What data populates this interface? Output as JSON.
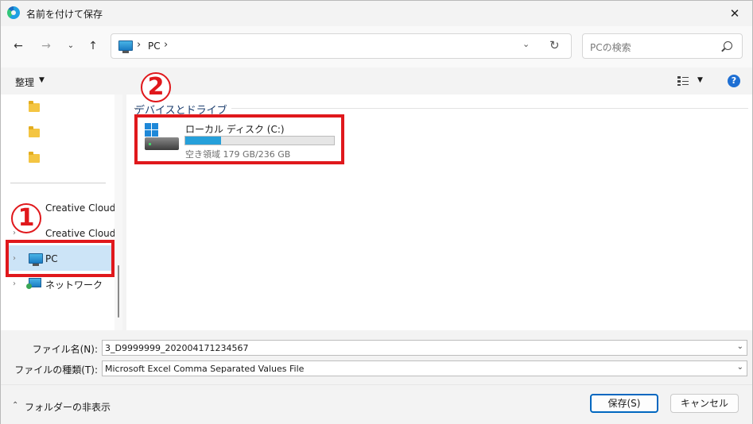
{
  "window": {
    "title": "名前を付けて保存"
  },
  "navbar": {
    "back_icon": "arrow-left-icon",
    "forward_icon": "arrow-right-icon",
    "recent_icon": "chevron-down-icon",
    "up_icon": "arrow-up-icon",
    "address_path": "PC",
    "search_placeholder": "PCの検索"
  },
  "cmdbar": {
    "organize_label": "整理"
  },
  "nav_pane": {
    "items": [
      {
        "label": "Creative Cloud F"
      },
      {
        "label": "Creative Cloud F"
      },
      {
        "label": "PC"
      },
      {
        "label": "ネットワーク"
      }
    ]
  },
  "annotations": {
    "marker1": "1",
    "marker2": "2",
    "color": "#e0181c"
  },
  "content": {
    "group_header": "デバイスとドライブ",
    "drive": {
      "name": "ローカル ディスク (C:)",
      "space": "空き領域 179 GB/236 GB",
      "used_fraction": 0.24
    }
  },
  "form": {
    "filename_label": "ファイル名(N):",
    "filename_value": "3_D9999999_202004171234567",
    "filetype_label": "ファイルの種類(T):",
    "filetype_value": "Microsoft Excel Comma Separated Values File"
  },
  "footer": {
    "hide_folders": "フォルダーの非表示",
    "save_label": "保存(S)",
    "cancel_label": "キャンセル"
  },
  "colors": {
    "accent": "#0067c0",
    "selection": "#cce4f7",
    "drive_bar": "#26a0da"
  }
}
